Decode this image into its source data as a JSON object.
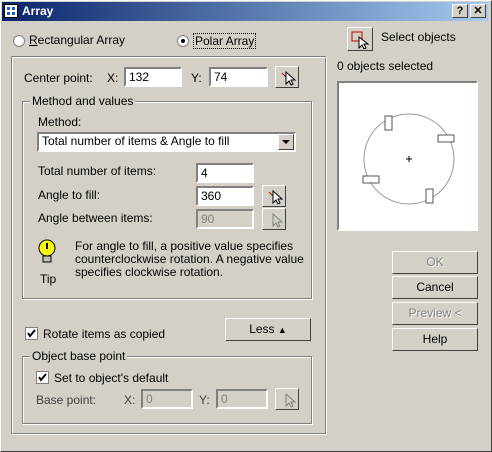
{
  "window": {
    "title": "Array",
    "help_glyph": "?",
    "close_glyph": "✕"
  },
  "mode": {
    "rectangular_label": "Rectangular Array",
    "polar_label": "Polar Array",
    "selected": "polar"
  },
  "select_objects": {
    "label": "Select objects",
    "status": "0 objects selected"
  },
  "center_point": {
    "label": "Center point:",
    "x_label": "X:",
    "x_value": "132",
    "y_label": "Y:",
    "y_value": "74"
  },
  "method_group": {
    "legend": "Method and values",
    "method_label": "Method:",
    "method_value": "Total number of items & Angle to fill",
    "total_items_label": "Total number of items:",
    "total_items_value": "4",
    "angle_fill_label": "Angle to fill:",
    "angle_fill_value": "360",
    "angle_between_label": "Angle between items:",
    "angle_between_value": "90"
  },
  "tip": {
    "label": "Tip",
    "lines": [
      "For angle to fill, a positive value specifies",
      "counterclockwise rotation.  A negative value",
      "specifies clockwise rotation."
    ]
  },
  "rotate": {
    "label": "Rotate items as copied",
    "checked": true
  },
  "less_button": {
    "label": "Less"
  },
  "base_group": {
    "legend": "Object base point",
    "default_label": "Set to object's default",
    "default_checked": true,
    "base_point_label": "Base point:",
    "x_label": "X:",
    "x_value": "0",
    "y_label": "Y:",
    "y_value": "0"
  },
  "buttons": {
    "ok": "OK",
    "cancel": "Cancel",
    "preview": "Preview <",
    "help": "Help"
  }
}
